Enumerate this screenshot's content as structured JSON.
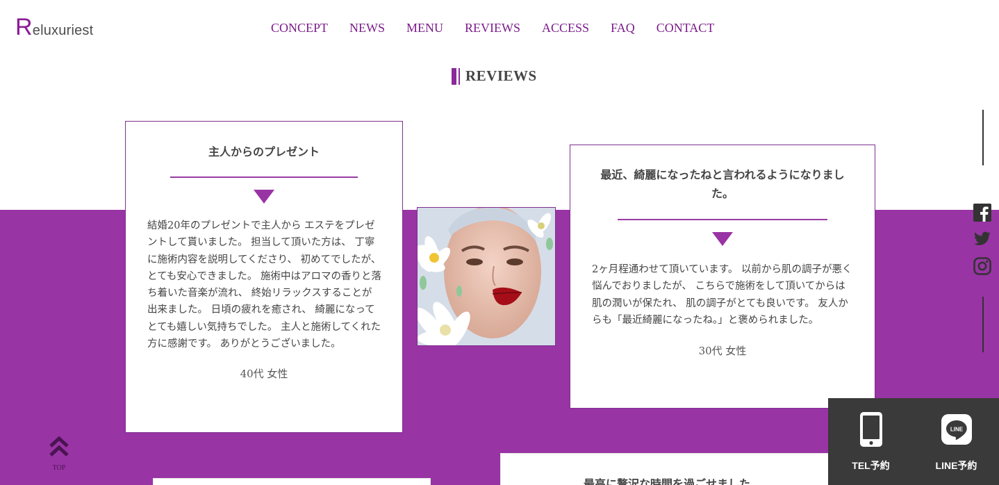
{
  "brand": {
    "logo_initial": "R",
    "logo_rest": "eluxuriest"
  },
  "nav": {
    "items": [
      {
        "label": "CONCEPT"
      },
      {
        "label": "NEWS"
      },
      {
        "label": "MENU"
      },
      {
        "label": "REVIEWS"
      },
      {
        "label": "ACCESS"
      },
      {
        "label": "FAQ"
      },
      {
        "label": "CONTACT"
      }
    ]
  },
  "section": {
    "title": "REVIEWS"
  },
  "reviews": [
    {
      "title": "主人からのプレゼント",
      "body": "結婚20年のプレゼントで主人から エステをプレゼントして貰いました。 担当して頂いた方は、 丁寧に施術内容を説明してくださり、 初めてでしたが、とても安心できました。 施術中はアロマの香りと落ち着いた音楽が流れ、 終始リラックスすることが出来ました。 日頃の疲れを癒され、 綺麗になってとても嬉しい気持ちでした。 主人と施術してくれた方に感謝です。 ありがとうございました。",
      "author": "40代 女性"
    },
    {
      "title": "最近、綺麗になったねと言われるようになりました。",
      "body": "2ヶ月程通わせて頂いています。 以前から肌の調子が悪く悩んでおりましたが、 こちらで施術をして頂いてからは肌の潤いが保たれ、 肌の調子がとても良いです。 友人からも「最近綺麗になったね。」と褒められました。",
      "author": "30代 女性"
    },
    {
      "title": "最高に贅沢な時間を過ごせました"
    }
  ],
  "booking": {
    "tel_label": "TEL予約",
    "line_label": "LINE予約",
    "line_icon_text": "LINE"
  },
  "to_top": {
    "label": "TOP"
  },
  "colors": {
    "accent": "#9934a4",
    "nav": "#7b1c8a",
    "booking_bg": "#3a3a3a"
  },
  "icons": [
    "facebook-icon",
    "twitter-icon",
    "instagram-icon",
    "smartphone-icon",
    "line-icon",
    "double-chevron-up-icon"
  ]
}
